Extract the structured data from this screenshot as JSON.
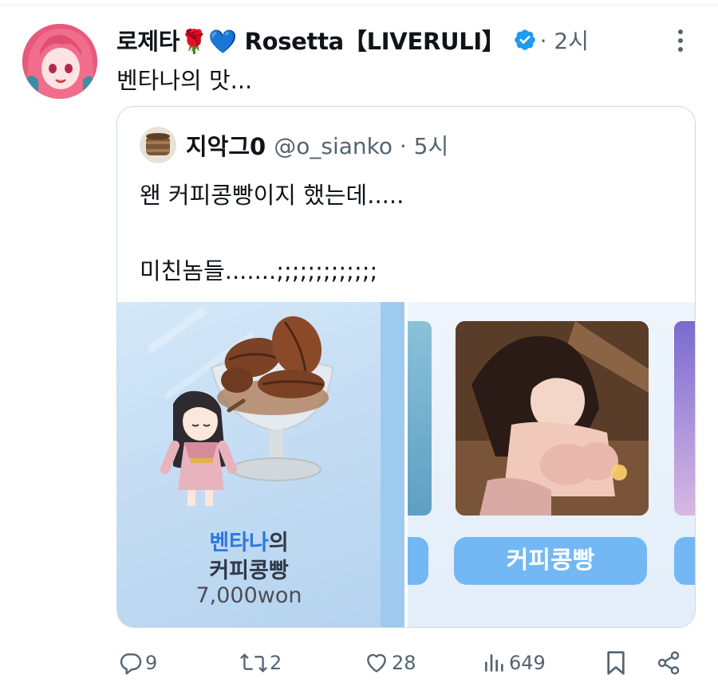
{
  "tweet": {
    "display_name": "로제타🌹💙 Rosetta【LIVERULI】",
    "verified": true,
    "meta": "· 2시",
    "text": "벤타나의 맛..."
  },
  "quote": {
    "name": "지악그0",
    "handle_meta": "@o_sianko · 5시",
    "line1": "왠 커피콩빵이지 했는데.....",
    "line2": "미친놈들.......;;;;;;;;;;;;;",
    "media_left": {
      "product_name_accent": "벤타나",
      "product_name_rest": "의",
      "product_name_line2": "커피콩빵",
      "price": "7,000won"
    },
    "media_right": {
      "button_label": "커피콩빵"
    }
  },
  "actions": {
    "replies": "9",
    "retweets": "2",
    "likes": "28",
    "views": "649"
  },
  "colors": {
    "accent": "#1d9bf0",
    "muted": "#536471",
    "product_button": "#73b8f4"
  },
  "icons": [
    "more-icon",
    "verified-icon",
    "reply-icon",
    "retweet-icon",
    "like-icon",
    "views-icon",
    "bookmark-icon",
    "share-icon"
  ]
}
